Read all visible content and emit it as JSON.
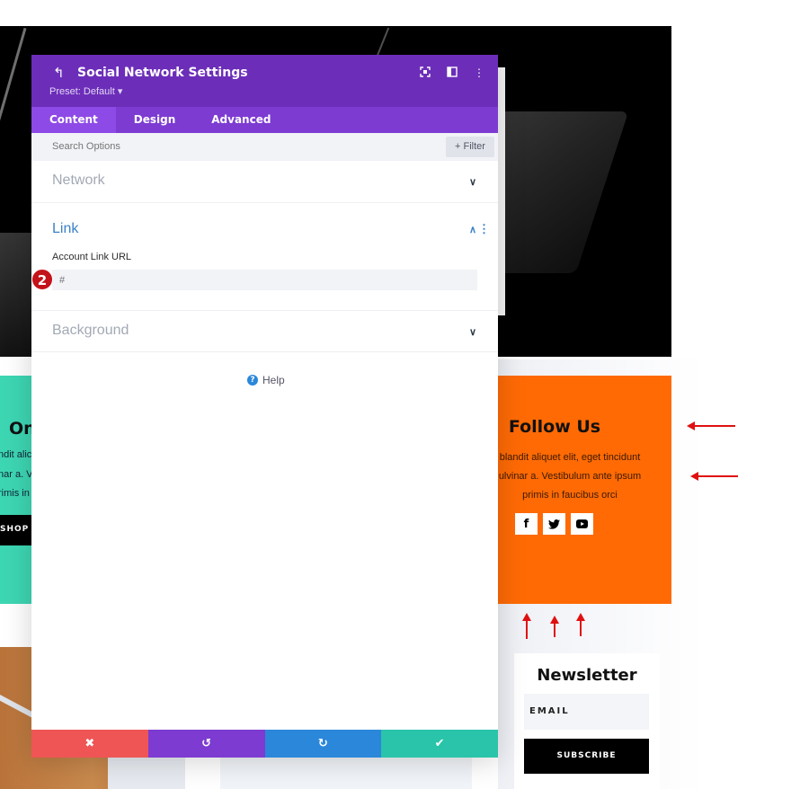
{
  "modal": {
    "title": "Social Network Settings",
    "preset": "Preset: Default ▾",
    "back_icon": "↰",
    "header_icons": [
      {
        "name": "focus-mode-icon",
        "glyph": "⧈"
      },
      {
        "name": "split-view-icon",
        "glyph": "◫"
      },
      {
        "name": "more-options-icon",
        "glyph": "⋮"
      }
    ],
    "tabs": [
      {
        "label": "Content",
        "active": true
      },
      {
        "label": "Design",
        "active": false
      },
      {
        "label": "Advanced",
        "active": false
      }
    ],
    "search": {
      "placeholder": "Search Options",
      "filter_label": "+ Filter"
    },
    "sections": {
      "network": {
        "title": "Network",
        "chevron": "∨"
      },
      "link": {
        "title": "Link",
        "chevron": "∧",
        "kebab": "⋮",
        "field_label": "Account Link URL",
        "field_value": "",
        "field_placeholder": "#",
        "step_badge": "2"
      },
      "background": {
        "title": "Background",
        "chevron": "∨"
      }
    },
    "help": {
      "icon": "?",
      "label": "Help"
    },
    "footer": {
      "cancel": "✖",
      "undo": "↺",
      "redo": "↻",
      "save": "✔",
      "colors": {
        "cancel": "#ef5555",
        "undo": "#7d3bd2",
        "redo": "#2b87da",
        "save": "#29c4a9"
      }
    }
  },
  "page": {
    "teal_card": {
      "title": "On",
      "lines": [
        "ndit alic",
        "nar a. V",
        "rimis in"
      ],
      "button": "SHOP S"
    },
    "follow_card": {
      "title": "Follow Us",
      "text": "blandit aliquet elit, eget tincidunt ulvinar a. Vestibulum ante ipsum primis in faucibus orci",
      "socials": [
        {
          "name": "facebook-icon",
          "glyph": "f"
        },
        {
          "name": "twitter-icon",
          "glyph": "❱"
        },
        {
          "name": "youtube-icon",
          "glyph": "▶"
        }
      ]
    },
    "newsletter": {
      "title": "Newsletter",
      "email_placeholder": "EMAIL",
      "subscribe": "SUBSCRIBE"
    }
  },
  "colors": {
    "header_purple": "#6c2eb9",
    "tab_purple": "#7d3bd2",
    "accent_blue": "#3b82c6",
    "teal": "#3dd6b3",
    "orange": "#ff6a05",
    "annotation_red": "#e01010"
  }
}
